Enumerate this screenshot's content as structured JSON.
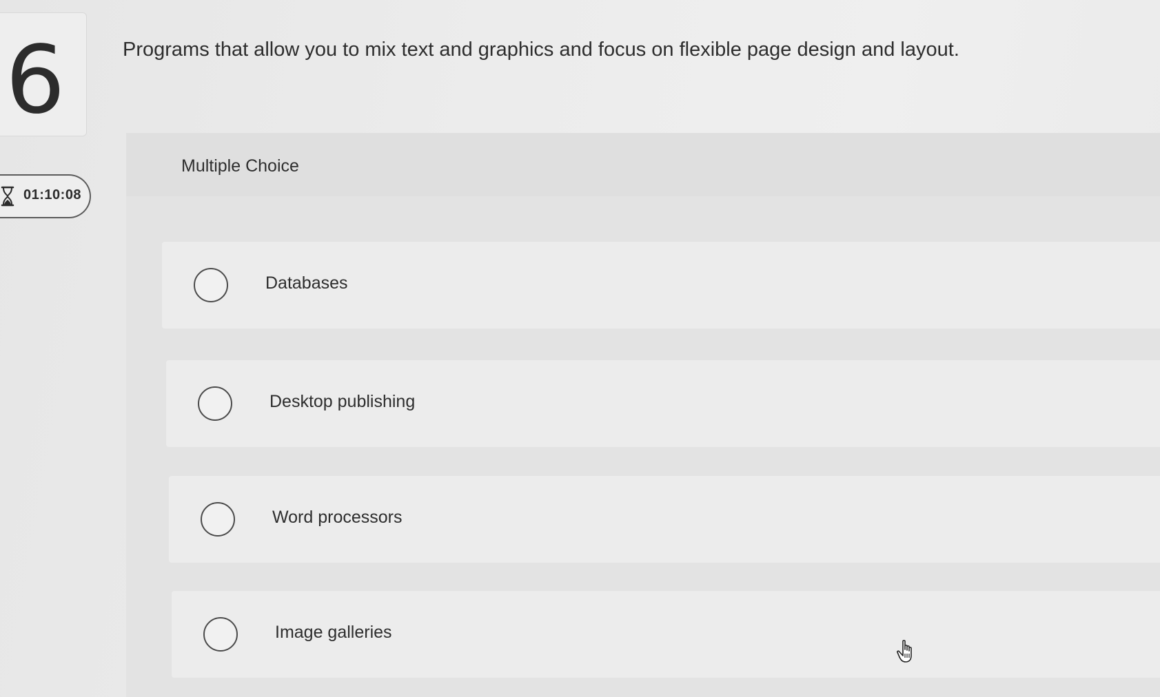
{
  "question": {
    "number": "6",
    "text": "Programs that allow you to mix text and graphics and focus on flexible page design and layout."
  },
  "timer": {
    "icon": "hourglass-icon",
    "value": "01:10:08"
  },
  "answer_section": {
    "type_label": "Multiple Choice",
    "options": [
      {
        "label": "Databases",
        "selected": false
      },
      {
        "label": "Desktop publishing",
        "selected": false
      },
      {
        "label": "Word processors",
        "selected": false
      },
      {
        "label": "Image galleries",
        "selected": false
      }
    ]
  },
  "cursor": {
    "icon": "hand-pointer-icon"
  }
}
